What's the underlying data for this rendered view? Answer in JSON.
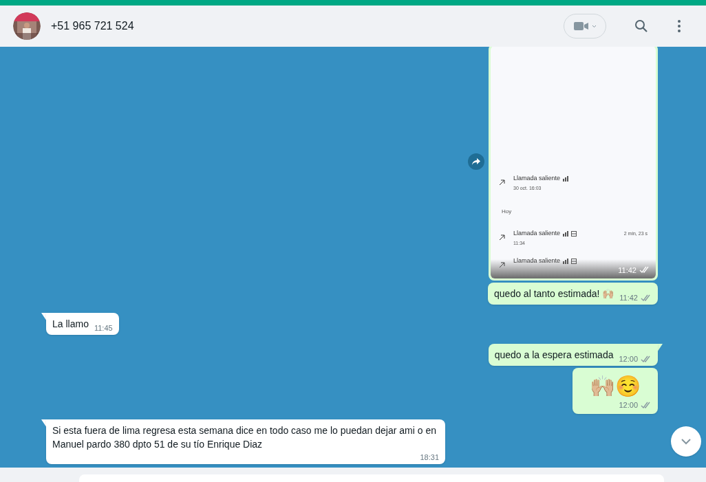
{
  "header": {
    "contact": "+51 965 721 524"
  },
  "messages": [
    {
      "outgoing": true,
      "time": "11:42",
      "delivered": true,
      "forward": true,
      "call_log": [
        {
          "kind": "call",
          "label": "Llamada saliente",
          "extra_icon": false,
          "time": "30 oct. 16:03"
        },
        {
          "kind": "heading",
          "label": "Hoy"
        },
        {
          "kind": "call",
          "label": "Llamada saliente",
          "extra_icon": true,
          "time": "11:34",
          "duration": "2 min, 23 s"
        },
        {
          "kind": "call",
          "label": "Llamada saliente",
          "extra_icon": true
        }
      ]
    },
    {
      "kind": "text",
      "outgoing": true,
      "text": "quedo al tanto estimada! 🙌🏼",
      "time": "11:42",
      "delivered": true,
      "tail": false
    },
    {
      "kind": "text",
      "outgoing": false,
      "text": "La llamo",
      "time": "11:45",
      "tail": true
    },
    {
      "kind": "text",
      "outgoing": true,
      "text": "quedo a la espera estimada",
      "time": "12:00",
      "delivered": true,
      "tail": true
    },
    {
      "kind": "emoji",
      "outgoing": true,
      "text": "🙌🏼☺️",
      "time": "12:00",
      "delivered": true,
      "tail": false
    },
    {
      "kind": "text",
      "outgoing": false,
      "text": "Si esta fuera de lima regresa esta semana dice en todo caso me lo puedan dejar ami o en Manuel pardo 380 dpto 51 de su tío Enrique Diaz",
      "time": "18:31",
      "tail": true
    }
  ]
}
